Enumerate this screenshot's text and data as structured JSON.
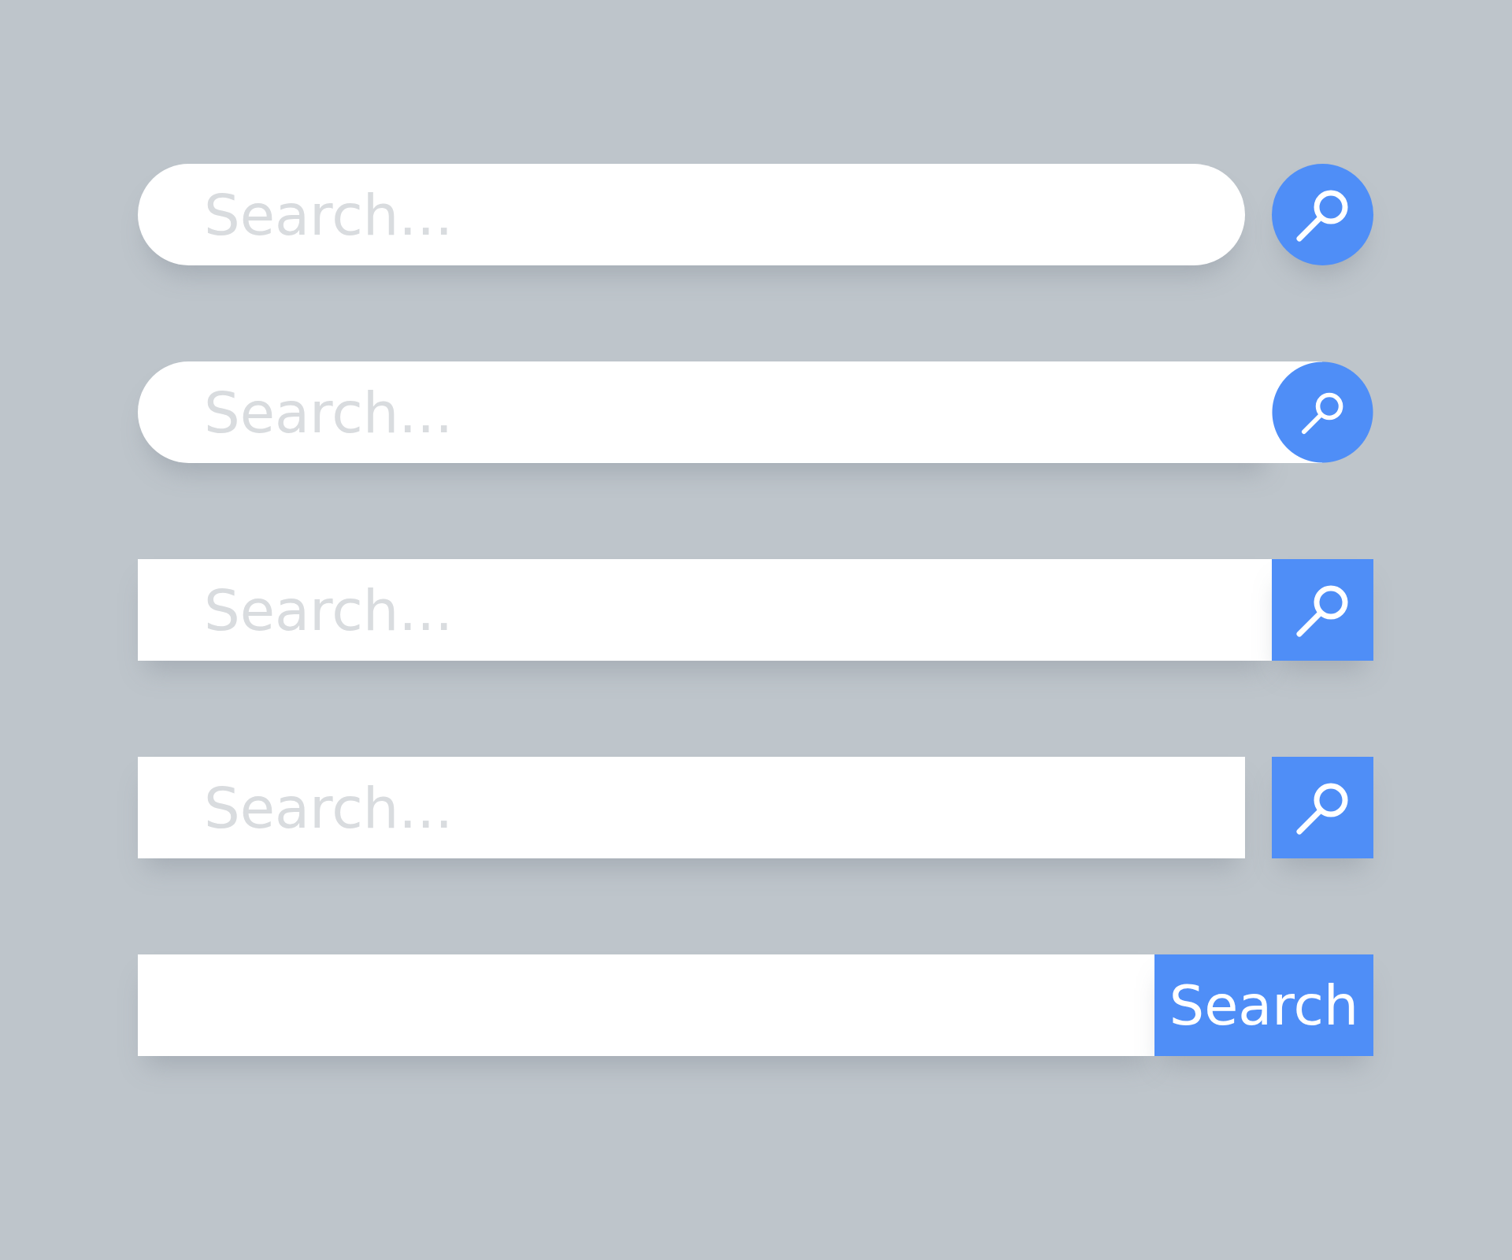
{
  "search_bars": [
    {
      "kind": "round-separate",
      "placeholder": "Search..."
    },
    {
      "kind": "round-overlap",
      "placeholder": "Search..."
    },
    {
      "kind": "square-attached",
      "placeholder": "Search..."
    },
    {
      "kind": "square-separate",
      "placeholder": "Search..."
    },
    {
      "kind": "text-button",
      "button_label": "Search"
    }
  ]
}
